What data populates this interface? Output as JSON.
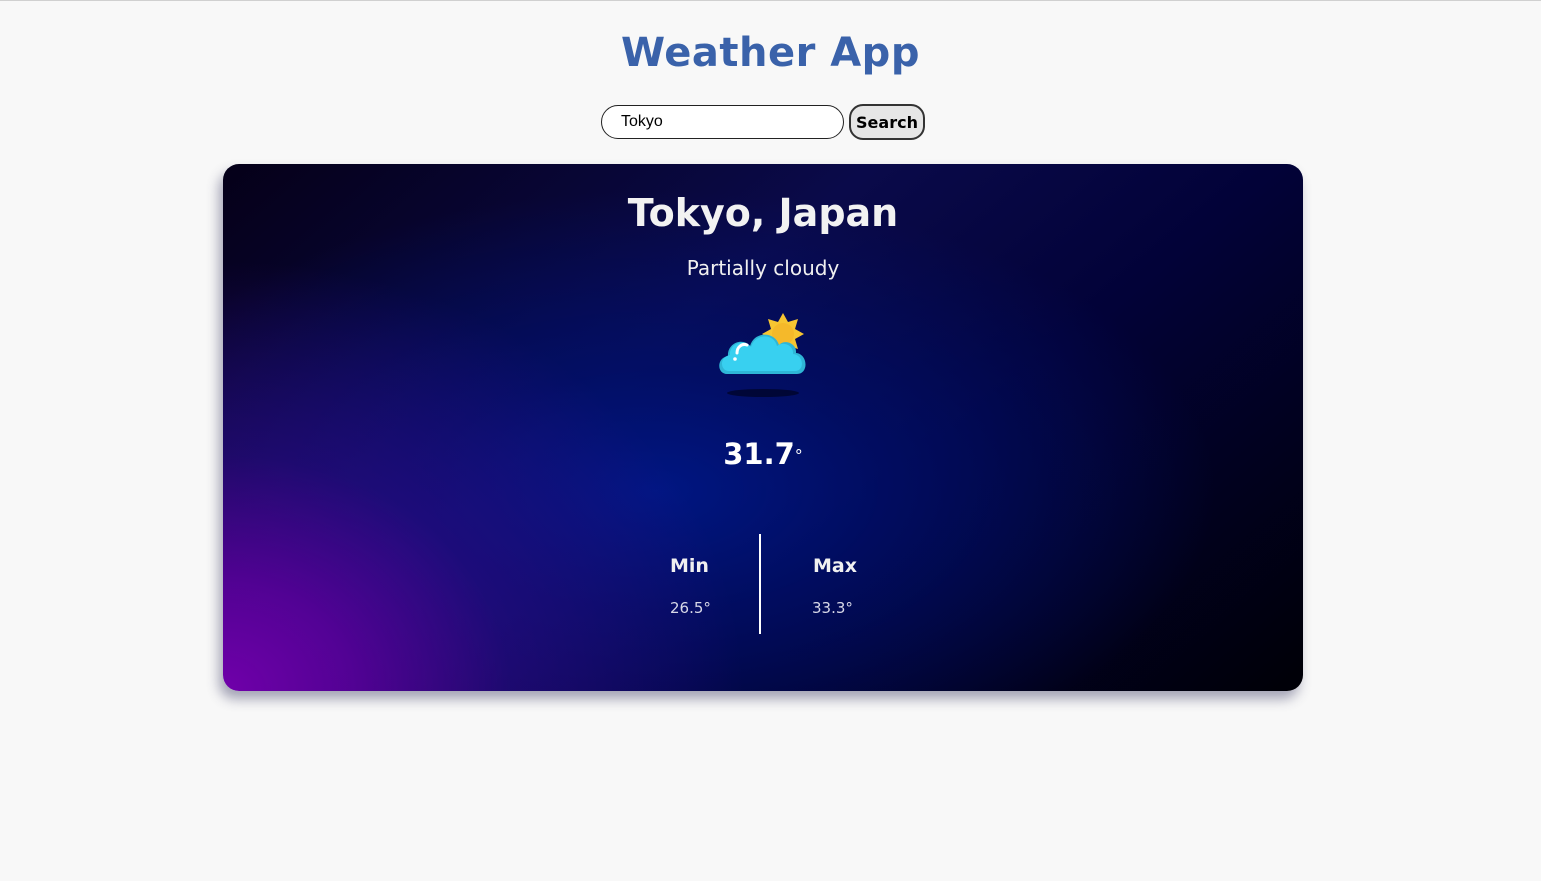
{
  "app": {
    "title": "Weather App"
  },
  "search": {
    "value": "Tokyo",
    "placeholder": "",
    "button_label": "Search"
  },
  "weather": {
    "location": "Tokyo, Japan",
    "condition": "Partially cloudy",
    "icon": "partly-cloudy-icon",
    "temperature": "31.7",
    "degree_symbol": "°",
    "min_label": "Min",
    "min_value": "26.5°",
    "max_label": "Max",
    "max_value": "33.3°"
  },
  "colors": {
    "title": "#3a62aa",
    "card_purple": "#7000aa",
    "card_blue": "#00167e",
    "card_dark": "#000006",
    "cloud": "#38d0f0",
    "sun": "#f7c531"
  }
}
